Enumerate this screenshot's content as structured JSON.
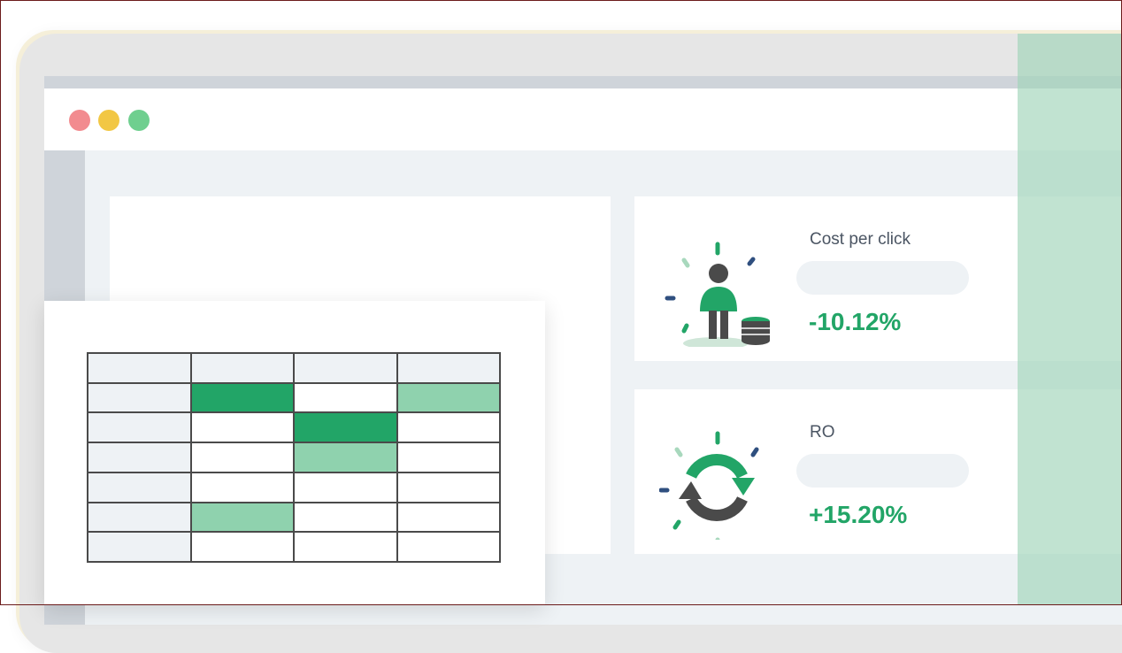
{
  "colors": {
    "accent_green": "#22a567",
    "light_green": "#8fd2ae",
    "window_red": "#f28b8f",
    "window_yellow": "#f2c744",
    "window_green": "#6fcf8f",
    "navy": "#2f4f7f",
    "charcoal": "#4a4a4a"
  },
  "window": {
    "controls": [
      "close-dot",
      "minimize-dot",
      "maximize-dot"
    ]
  },
  "cards": {
    "cpc": {
      "label": "Cost per click",
      "value": "-10.12%",
      "icon": "person-with-coins-icon"
    },
    "roi": {
      "label": "RO",
      "value": "+15.20%",
      "icon": "refresh-arrows-icon"
    }
  },
  "spreadsheet": {
    "columns": 4,
    "rows": [
      [
        "head",
        "head",
        "head",
        "head"
      ],
      [
        "head",
        "dark",
        "empty",
        "light"
      ],
      [
        "head",
        "empty",
        "dark",
        "empty"
      ],
      [
        "head",
        "empty",
        "light",
        "empty"
      ],
      [
        "head",
        "empty",
        "empty",
        "empty"
      ],
      [
        "head",
        "light",
        "empty",
        "empty"
      ],
      [
        "head",
        "empty",
        "empty",
        "empty"
      ]
    ]
  }
}
